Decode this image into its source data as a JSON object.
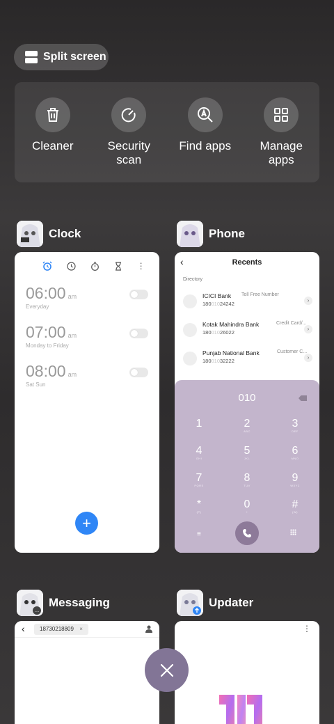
{
  "split_screen": {
    "label": "Split screen"
  },
  "tools": [
    {
      "label": "Cleaner",
      "icon": "trash-icon"
    },
    {
      "label": "Security\nscan",
      "icon": "security-scan-icon"
    },
    {
      "label": "Find apps",
      "icon": "search-apps-icon"
    },
    {
      "label": "Manage\napps",
      "icon": "grid-icon"
    }
  ],
  "apps": {
    "clock": {
      "name": "Clock",
      "alarms": [
        {
          "time": "06:00",
          "ampm": "am",
          "days": "Everyday"
        },
        {
          "time": "07:00",
          "ampm": "am",
          "days": "Monday to Friday"
        },
        {
          "time": "08:00",
          "ampm": "am",
          "days": "Sat Sun"
        }
      ],
      "fab": "+"
    },
    "phone": {
      "name": "Phone",
      "title": "Recents",
      "section": "Directory",
      "contacts": [
        {
          "name": "ICICI Bank",
          "tag": "Toll Free Number",
          "num_pre": "180",
          "num_hl": "010",
          "num_post": "24242"
        },
        {
          "name": "Kotak Mahindra Bank",
          "tag": "Credit Card/...",
          "num_pre": "180",
          "num_hl": "010",
          "num_post": "26022"
        },
        {
          "name": "Punjab National Bank",
          "tag": "Customer C...",
          "num_pre": "180",
          "num_hl": "010",
          "num_post": "32222"
        }
      ],
      "dial_number": "010",
      "keys": [
        {
          "d": "1",
          "s": ""
        },
        {
          "d": "2",
          "s": "ABC"
        },
        {
          "d": "3",
          "s": "DEF"
        },
        {
          "d": "4",
          "s": "GHI"
        },
        {
          "d": "5",
          "s": "JKL"
        },
        {
          "d": "6",
          "s": "MNO"
        },
        {
          "d": "7",
          "s": "PQRS"
        },
        {
          "d": "8",
          "s": "TUV"
        },
        {
          "d": "9",
          "s": "WXYZ"
        },
        {
          "d": "*",
          "s": "(P)"
        },
        {
          "d": "0",
          "s": "+"
        },
        {
          "d": "#",
          "s": "(W)"
        }
      ]
    },
    "messaging": {
      "name": "Messaging",
      "recipient": "18730218809",
      "chip_close": "×"
    },
    "updater": {
      "name": "Updater"
    }
  },
  "colors": {
    "accent_blue": "#2f86f6",
    "dialpad": "#c3b5cc",
    "close_fab": "#827596"
  }
}
